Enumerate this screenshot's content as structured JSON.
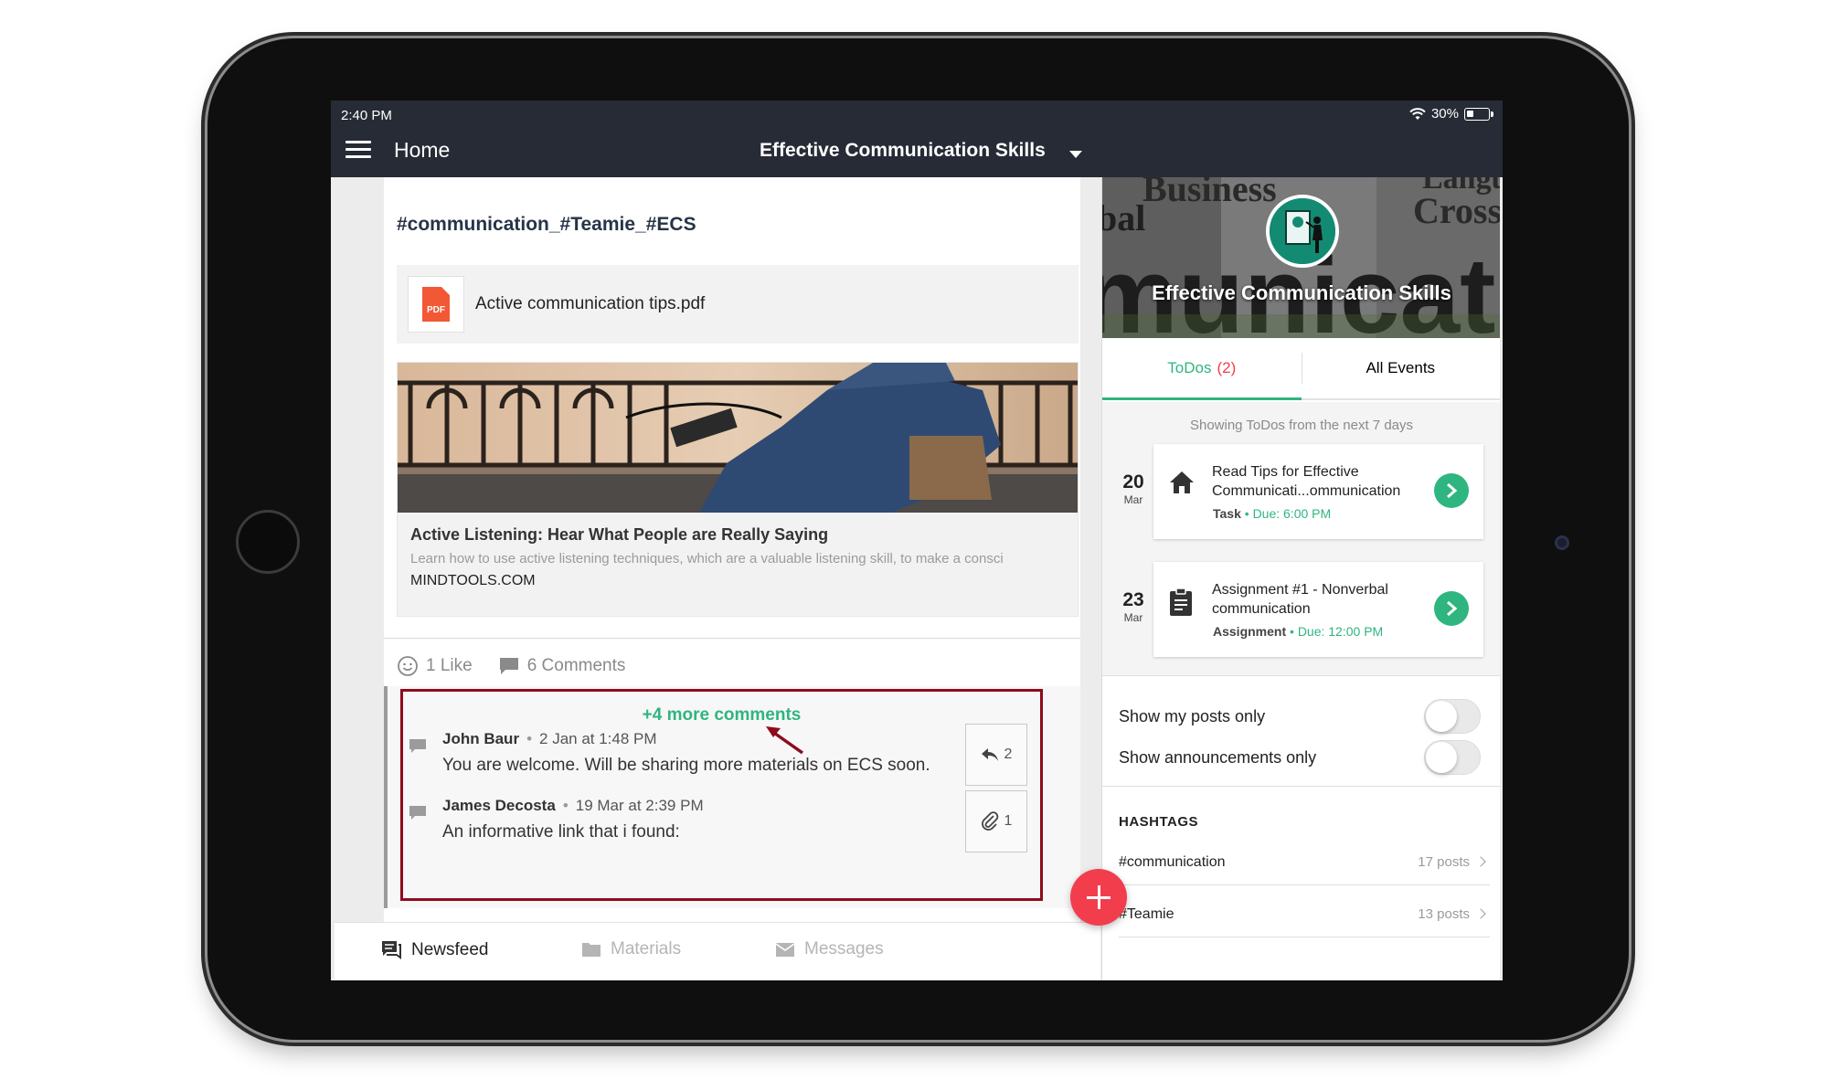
{
  "status_bar": {
    "time": "2:40 PM",
    "battery": "30%"
  },
  "header": {
    "title": "Home",
    "course": "Effective Communication Skills"
  },
  "post": {
    "hashtags": "#communication_#Teamie_#ECS",
    "attachment": {
      "icon": "pdf-icon",
      "icon_label": "PDF",
      "name": "Active communication tips.pdf"
    },
    "link_preview": {
      "title": "Active Listening: Hear What People are Really Saying",
      "description": "Learn how to use active listening techniques, which are a valuable listening skill, to make a consci",
      "domain": "MINDTOOLS.COM"
    },
    "likes": "1 Like",
    "comments_count": "6 Comments",
    "more_comments": "+4 more comments",
    "comments": [
      {
        "author": "John Baur",
        "time": "2 Jan at 1:48 PM",
        "text": "You are welcome. Will be sharing more materials on ECS soon.",
        "action_icon": "reply-icon",
        "action_count": "2"
      },
      {
        "author": "James Decosta",
        "time": "19 Mar at 2:39 PM",
        "text": "An informative link that i found:",
        "action_icon": "paperclip-icon",
        "action_count": "1"
      }
    ]
  },
  "bottom_nav": [
    {
      "label": "Newsfeed",
      "icon": "newsfeed-icon",
      "active": true
    },
    {
      "label": "Materials",
      "icon": "folder-icon",
      "active": false
    },
    {
      "label": "Messages",
      "icon": "envelope-icon",
      "active": false
    }
  ],
  "sidebar": {
    "course_title": "Effective Communication Skills",
    "banner_words": [
      "Business",
      "Langu",
      "Cross",
      "bal",
      "municat"
    ],
    "tabs": {
      "todos_label": "ToDos",
      "todos_count": "(2)",
      "events_label": "All Events"
    },
    "todo_caption": "Showing ToDos from the next 7 days",
    "todos": [
      {
        "day": "20",
        "month": "Mar",
        "icon": "home-icon",
        "title": "Read Tips for Effective Communicati...ommunication",
        "type": "Task",
        "due": "Due: 6:00 PM"
      },
      {
        "day": "23",
        "month": "Mar",
        "icon": "clipboard-icon",
        "title": "Assignment #1 - Nonverbal communication",
        "type": "Assignment",
        "due": "Due: 12:00 PM"
      }
    ],
    "filters": {
      "my_posts": "Show my posts only",
      "announcements": "Show announcements only"
    },
    "hashtags_heading": "HASHTAGS",
    "hashtag_list": [
      {
        "name": "#communication",
        "count": "17 posts"
      },
      {
        "name": "#Teamie",
        "count": "13 posts"
      }
    ]
  },
  "colors": {
    "topbar": "#262b35",
    "accent_green": "#2fb57f",
    "fab_red": "#f23d4d",
    "highlight_border": "#8e0b1d"
  }
}
